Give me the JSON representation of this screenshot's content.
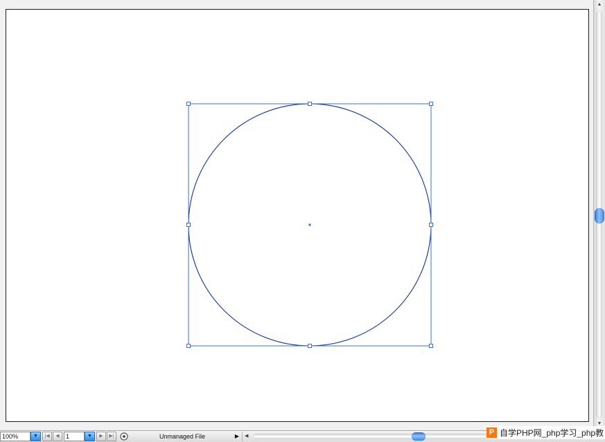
{
  "statusbar": {
    "zoom_value": "100%",
    "zoom_dropdown_glyph": "▼",
    "page_value": "1",
    "page_dropdown_glyph": "▼",
    "first_page_glyph": "|◀",
    "prev_page_glyph": "◀",
    "next_page_glyph": "▶",
    "last_page_glyph": "▶|",
    "status_label": "Unmanaged File",
    "status_menu_glyph": "▶"
  },
  "scrollbars": {
    "up_glyph": "▲",
    "down_glyph": "▼",
    "left_glyph": "◀"
  },
  "watermark": {
    "logo_letter": "P",
    "text": "自学PHP网_php学习_php教"
  },
  "colors": {
    "selection": "#3b6fd6",
    "path_stroke": "#1f3f9a",
    "artboard_border": "#1b1b1b",
    "scroll_thumb": "#3d86e8",
    "watermark_logo": "#f07a1a"
  }
}
